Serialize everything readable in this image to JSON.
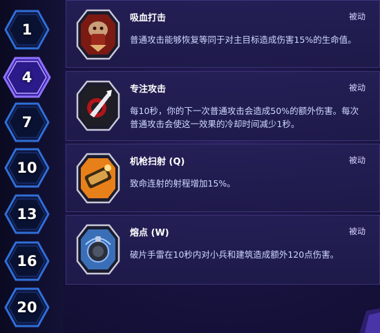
{
  "tiers": [
    {
      "level": "1",
      "active": false
    },
    {
      "level": "4",
      "active": true
    },
    {
      "level": "7",
      "active": false
    },
    {
      "level": "10",
      "active": false
    },
    {
      "level": "13",
      "active": false
    },
    {
      "level": "16",
      "active": false
    },
    {
      "level": "20",
      "active": false
    }
  ],
  "talents": [
    {
      "name": "吸血打击",
      "type": "被动",
      "description": "普通攻击能够恢复等同于对主目标造成伤害15%的生命值。",
      "icon": "blood-strike-icon"
    },
    {
      "name": "专注攻击",
      "type": "被动",
      "description": "每10秒，你的下一次普通攻击会造成50%的额外伤害。每次普通攻击会使这一效果的冷却时间减少1秒。",
      "icon": "focused-attack-icon"
    },
    {
      "name": "机枪扫射 (Q)",
      "type": "被动",
      "description": "致命连射的射程增加15%。",
      "icon": "gatling-gun-icon"
    },
    {
      "name": "熔点 (W)",
      "type": "被动",
      "description": "破片手雷在10秒内对小兵和建筑造成额外120点伤害。",
      "icon": "grenade-icon"
    }
  ],
  "colors": {
    "active_tier": "#7d5cff",
    "tier_border": "#2f6fd8",
    "panel_border": "#3a3578",
    "desc_text": "#cfd8ff"
  }
}
